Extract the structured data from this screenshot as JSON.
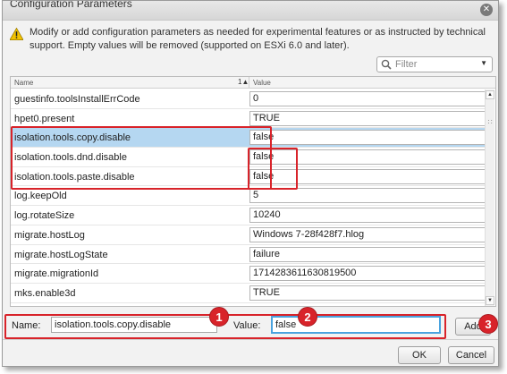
{
  "dialog": {
    "title": "Configuration Parameters"
  },
  "warning": {
    "icon": "warning-icon",
    "text": "Modify or add configuration parameters as needed for experimental features or as instructed by technical support. Empty values will be removed (supported on ESXi 6.0 and later)."
  },
  "filter": {
    "placeholder": "Filter"
  },
  "table": {
    "columns": [
      "Name",
      "Value"
    ],
    "sort_indicator": "1▲",
    "rows": [
      {
        "name": "guestinfo.toolsInstallErrCode",
        "value": "0"
      },
      {
        "name": "hpet0.present",
        "value": "TRUE"
      },
      {
        "name": "isolation.tools.copy.disable",
        "value": "false"
      },
      {
        "name": "isolation.tools.dnd.disable",
        "value": "false"
      },
      {
        "name": "isolation.tools.paste.disable",
        "value": "false"
      },
      {
        "name": "log.keepOld",
        "value": "5"
      },
      {
        "name": "log.rotateSize",
        "value": "10240"
      },
      {
        "name": "migrate.hostLog",
        "value": "Windows 7-28f428f7.hlog"
      },
      {
        "name": "migrate.hostLogState",
        "value": "failure"
      },
      {
        "name": "migrate.migrationId",
        "value": "1714283611630819500"
      },
      {
        "name": "mks.enable3d",
        "value": "TRUE"
      }
    ]
  },
  "editor": {
    "name_label": "Name:",
    "name_value": "isolation.tools.copy.disable",
    "value_label": "Value:",
    "value_value": "false",
    "add_label": "Add"
  },
  "badges": [
    "1",
    "2",
    "3"
  ],
  "footer": {
    "ok_label": "OK",
    "cancel_label": "Cancel"
  },
  "colors": {
    "callout": "#d8232a",
    "selection": "#b5d7f1",
    "focus": "#4aa3df"
  }
}
